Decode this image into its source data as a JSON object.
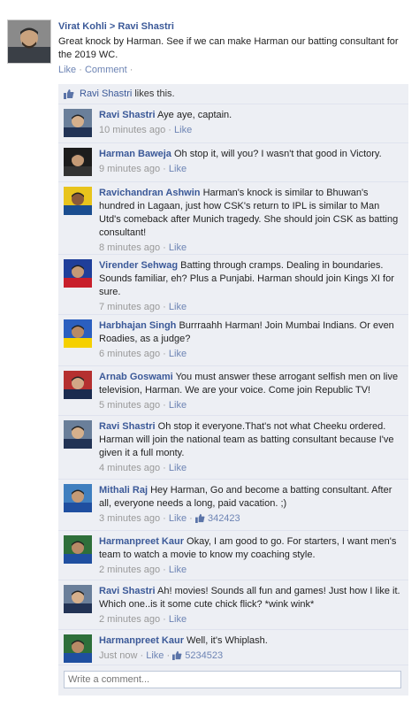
{
  "post": {
    "author": "Virat Kohli",
    "arrow": ">",
    "target": "Ravi Shastri",
    "text": "Great knock by Harman. See if we can make Harman our batting consultant for the 2019 WC.",
    "like_label": "Like",
    "comment_label": "Comment"
  },
  "likes": {
    "name": "Ravi Shastri",
    "suffix": "likes this."
  },
  "comments": [
    {
      "name": "Ravi Shastri",
      "text": "Aye aye, captain.",
      "time": "10 minutes ago",
      "like": "Like",
      "likes_count": ""
    },
    {
      "name": "Harman Baweja",
      "text": "Oh stop it, will you? I wasn't that good in Victory.",
      "time": "9 minutes ago",
      "like": "Like",
      "likes_count": ""
    },
    {
      "name": "Ravichandran Ashwin",
      "text": "Harman's knock is similar to Bhuwan's hundred in Lagaan, just how CSK's return to IPL is similar to Man Utd's comeback after Munich tragedy. She should join CSK as batting consultant!",
      "time": "8 minutes ago",
      "like": "Like",
      "likes_count": ""
    },
    {
      "name": "Virender Sehwag",
      "text": "Batting through cramps. Dealing in boundaries. Sounds familiar, eh? Plus a Punjabi. Harman should join Kings XI for sure.",
      "time": "7 minutes ago",
      "like": "Like",
      "likes_count": ""
    },
    {
      "name": "Harbhajan Singh",
      "text": "Burrraahh Harman! Join Mumbai Indians. Or even Roadies, as a judge?",
      "time": "6 minutes ago",
      "like": "Like",
      "likes_count": ""
    },
    {
      "name": "Arnab Goswami",
      "text": "You must answer these arrogant selfish men on live television, Harman. We are your voice. Come join Republic TV!",
      "time": "5 minutes ago",
      "like": "Like",
      "likes_count": ""
    },
    {
      "name": "Ravi Shastri",
      "text": "Oh stop it everyone.That's not what Cheeku ordered. Harman will join the national team as batting consultant because I've given it a full monty.",
      "time": "4 minutes ago",
      "like": "Like",
      "likes_count": ""
    },
    {
      "name": "Mithali Raj",
      "text": "Hey Harman, Go and become a batting consultant. After all, everyone needs a long, paid vacation. ;)",
      "time": "3 minutes ago",
      "like": "Like",
      "likes_count": "342423"
    },
    {
      "name": "Harmanpreet Kaur",
      "text": "Okay, I am good to go. For starters, I want men's team to watch a movie to know my coaching style.",
      "time": "2 minutes ago",
      "like": "Like",
      "likes_count": ""
    },
    {
      "name": "Ravi Shastri",
      "text": "Ah! movies! Sounds all fun and games! Just how I like it.  Which one..is it some cute chick flick? *wink wink*",
      "time": "2 minutes ago",
      "like": "Like",
      "likes_count": ""
    },
    {
      "name": "Harmanpreet Kaur",
      "text": "Well, it's Whiplash.",
      "time": "Just now",
      "like": "Like",
      "likes_count": "5234523"
    }
  ],
  "write_comment": {
    "placeholder": "Write a comment..."
  },
  "colors": {
    "link": "#3b5998",
    "comment_bg": "#edeff4",
    "meta": "#999999"
  }
}
